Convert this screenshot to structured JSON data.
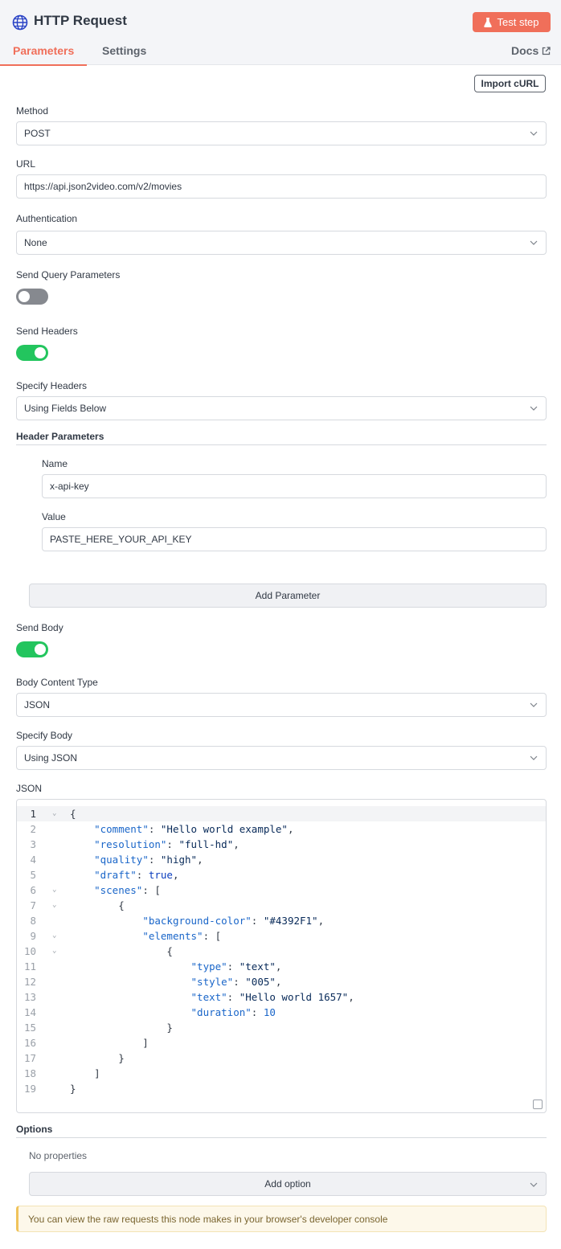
{
  "header": {
    "title": "HTTP Request",
    "test_step_label": "Test step",
    "tabs": [
      {
        "label": "Parameters",
        "active": true
      },
      {
        "label": "Settings",
        "active": false
      }
    ],
    "docs_label": "Docs"
  },
  "import_curl_label": "Import cURL",
  "method": {
    "label": "Method",
    "value": "POST"
  },
  "url": {
    "label": "URL",
    "value": "https://api.json2video.com/v2/movies"
  },
  "authentication": {
    "label": "Authentication",
    "value": "None"
  },
  "send_query": {
    "label": "Send Query Parameters",
    "on": false
  },
  "send_headers": {
    "label": "Send Headers",
    "on": true
  },
  "specify_headers": {
    "label": "Specify Headers",
    "value": "Using Fields Below"
  },
  "header_parameters": {
    "label": "Header Parameters",
    "name_label": "Name",
    "name_value": "x-api-key",
    "value_label": "Value",
    "value_value": "PASTE_HERE_YOUR_API_KEY",
    "add_label": "Add Parameter"
  },
  "send_body": {
    "label": "Send Body",
    "on": true
  },
  "body_content_type": {
    "label": "Body Content Type",
    "value": "JSON"
  },
  "specify_body": {
    "label": "Specify Body",
    "value": "Using JSON"
  },
  "json_editor": {
    "label": "JSON",
    "line_numbers": [
      "1",
      "2",
      "3",
      "4",
      "5",
      "6",
      "7",
      "8",
      "9",
      "10",
      "11",
      "12",
      "13",
      "14",
      "15",
      "16",
      "17",
      "18",
      "19"
    ]
  },
  "options": {
    "label": "Options",
    "empty_text": "No properties",
    "add_label": "Add option"
  },
  "notice": "You can view the raw requests this node makes in your browser's developer console",
  "colors": {
    "accent": "#f06f5a",
    "toggle_on": "#23c55e",
    "toggle_off": "#86898f",
    "json_key": "#1a66c9",
    "json_string": "#082a59"
  }
}
